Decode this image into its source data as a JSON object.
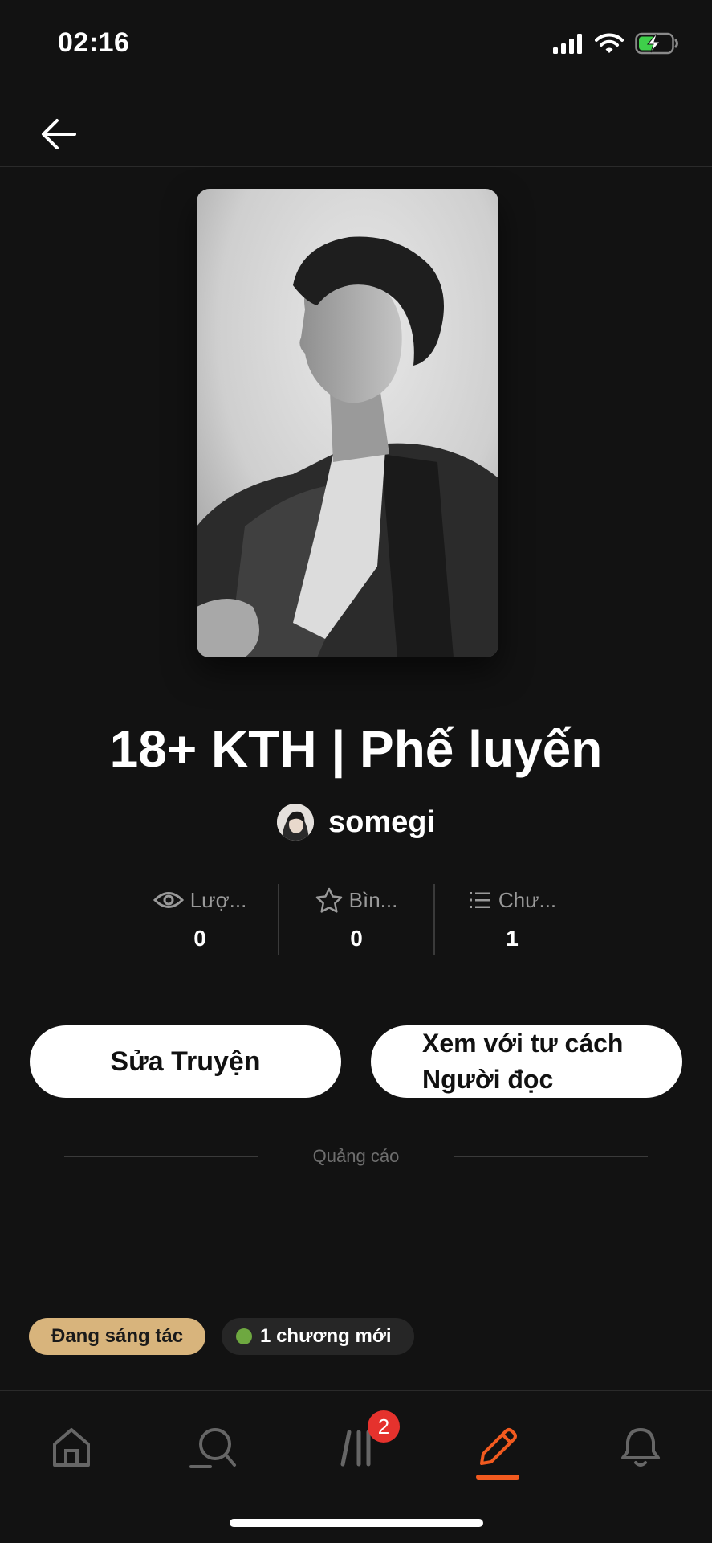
{
  "status_bar": {
    "time": "02:16"
  },
  "story": {
    "title": "18+ KTH | Phế luyến",
    "author": "somegi"
  },
  "stats": [
    {
      "icon": "eye-icon",
      "label": "Lượ...",
      "value": "0"
    },
    {
      "icon": "star-icon",
      "label": "Bìn...",
      "value": "0"
    },
    {
      "icon": "list-icon",
      "label": "Chư...",
      "value": "1"
    }
  ],
  "actions": {
    "edit_label": "Sửa Truyện",
    "reader_label_line1": "Xem với tư cách",
    "reader_label_line2": "Người đọc"
  },
  "ad_label": "Quảng cáo",
  "tags": {
    "status": "Đang sáng tác",
    "new_chapters": "1 chương mới"
  },
  "bottom_nav": {
    "tabs": [
      {
        "name": "home-icon"
      },
      {
        "name": "search-icon"
      },
      {
        "name": "library-icon",
        "badge": "2"
      },
      {
        "name": "pencil-icon",
        "active": true
      },
      {
        "name": "bell-icon"
      }
    ]
  },
  "colors": {
    "background": "#121212",
    "accent": "#f25a1f",
    "status_tag": "#d8b47c",
    "badge": "#e5322d",
    "new_dot": "#6ea840"
  }
}
